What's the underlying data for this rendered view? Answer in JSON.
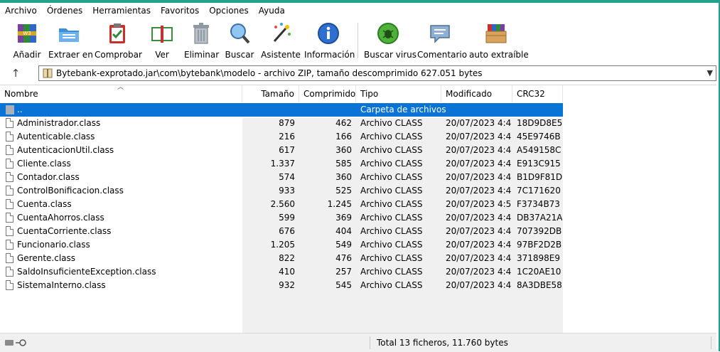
{
  "menu": [
    "Archivo",
    "Órdenes",
    "Herramientas",
    "Favoritos",
    "Opciones",
    "Ayuda"
  ],
  "toolbar": [
    {
      "label": "Añadir",
      "icon": "add-books-icon"
    },
    {
      "label": "Extraer en",
      "icon": "extract-folder-icon"
    },
    {
      "label": "Comprobar",
      "icon": "test-clipboard-icon"
    },
    {
      "label": "Ver",
      "icon": "view-book-icon"
    },
    {
      "label": "Eliminar",
      "icon": "trash-icon"
    },
    {
      "label": "Buscar",
      "icon": "magnifier-icon"
    },
    {
      "label": "Asistente",
      "icon": "wizard-wand-icon"
    },
    {
      "label": "Información",
      "icon": "info-icon"
    },
    {
      "label": "Buscar virus",
      "icon": "virus-scan-icon"
    },
    {
      "label": "Comentario",
      "icon": "comment-icon"
    },
    {
      "label": "auto extraíble",
      "icon": "sfx-box-icon"
    }
  ],
  "address": {
    "path": "Bytebank-exprotado.jar\\com\\bytebank\\modelo - archivo ZIP, tamaño descomprimido 627.051 bytes"
  },
  "columns": {
    "name": "Nombre",
    "size": "Tamaño",
    "packed": "Comprimido",
    "type": "Tipo",
    "modified": "Modificado",
    "crc": "CRC32"
  },
  "parent_row": {
    "name": "..",
    "type": "Carpeta de archivos"
  },
  "files": [
    {
      "name": "Administrador.class",
      "size": "879",
      "packed": "462",
      "type": "Archivo CLASS",
      "modified": "20/07/2023 4:4...",
      "crc": "18D9D8E5"
    },
    {
      "name": "Autenticable.class",
      "size": "216",
      "packed": "166",
      "type": "Archivo CLASS",
      "modified": "20/07/2023 4:4...",
      "crc": "45E9746B"
    },
    {
      "name": "AutenticacionUtil.class",
      "size": "617",
      "packed": "360",
      "type": "Archivo CLASS",
      "modified": "20/07/2023 4:4...",
      "crc": "A549158C"
    },
    {
      "name": "Cliente.class",
      "size": "1.337",
      "packed": "585",
      "type": "Archivo CLASS",
      "modified": "20/07/2023 4:4...",
      "crc": "E913C915"
    },
    {
      "name": "Contador.class",
      "size": "574",
      "packed": "360",
      "type": "Archivo CLASS",
      "modified": "20/07/2023 4:4...",
      "crc": "B1D9F81D"
    },
    {
      "name": "ControlBonificacion.class",
      "size": "933",
      "packed": "525",
      "type": "Archivo CLASS",
      "modified": "20/07/2023 4:4...",
      "crc": "7C171620"
    },
    {
      "name": "Cuenta.class",
      "size": "2.560",
      "packed": "1.245",
      "type": "Archivo CLASS",
      "modified": "20/07/2023 4:5...",
      "crc": "F3734B73"
    },
    {
      "name": "CuentaAhorros.class",
      "size": "599",
      "packed": "369",
      "type": "Archivo CLASS",
      "modified": "20/07/2023 4:4...",
      "crc": "DB37A21A"
    },
    {
      "name": "CuentaCorriente.class",
      "size": "676",
      "packed": "404",
      "type": "Archivo CLASS",
      "modified": "20/07/2023 4:4...",
      "crc": "707392DB"
    },
    {
      "name": "Funcionario.class",
      "size": "1.205",
      "packed": "549",
      "type": "Archivo CLASS",
      "modified": "20/07/2023 4:4...",
      "crc": "97BF2D2B"
    },
    {
      "name": "Gerente.class",
      "size": "822",
      "packed": "476",
      "type": "Archivo CLASS",
      "modified": "20/07/2023 4:4...",
      "crc": "371898E9"
    },
    {
      "name": "SaldoInsuficienteException.class",
      "size": "410",
      "packed": "257",
      "type": "Archivo CLASS",
      "modified": "20/07/2023 4:4...",
      "crc": "1C20AE10"
    },
    {
      "name": "SistemaInterno.class",
      "size": "932",
      "packed": "545",
      "type": "Archivo CLASS",
      "modified": "20/07/2023 4:4...",
      "crc": "8A3DBE58"
    }
  ],
  "status": {
    "text": "Total 13 ficheros, 11.760 bytes"
  },
  "colors": {
    "accent": "#1fa38a",
    "selection": "#0a74d6"
  }
}
